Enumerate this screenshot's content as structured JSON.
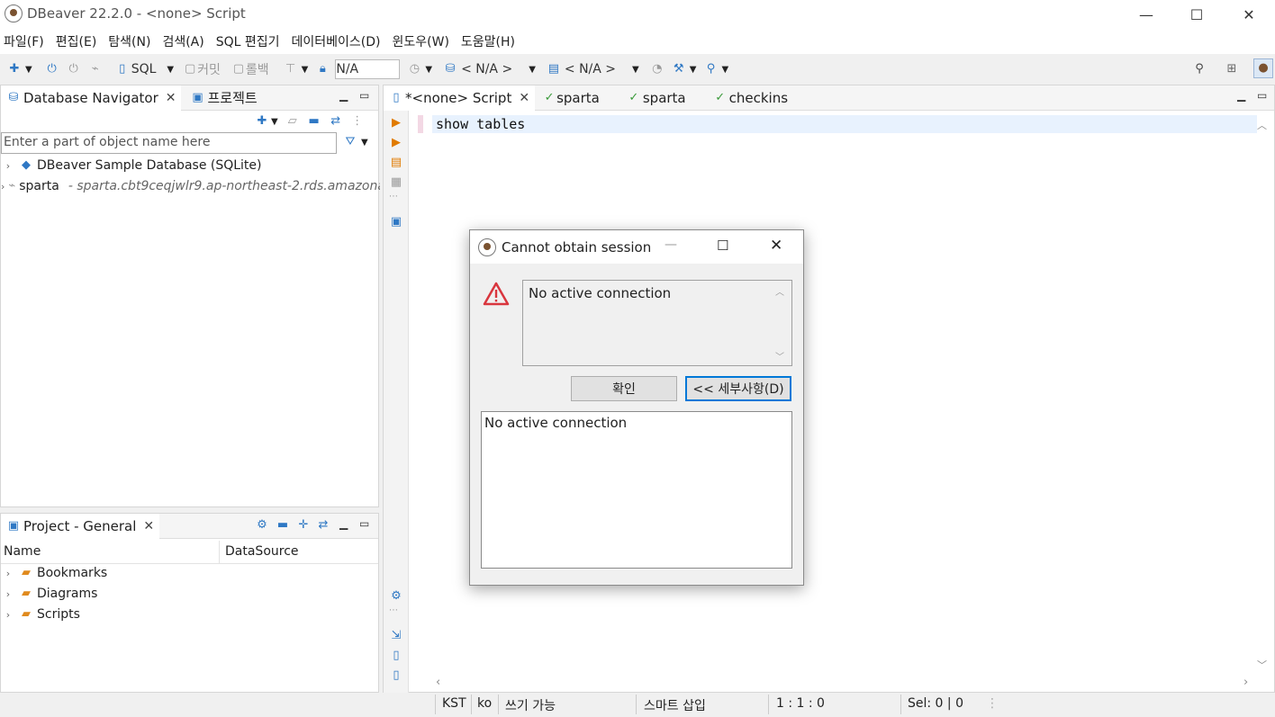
{
  "window": {
    "title": "DBeaver 22.2.0 - <none> Script",
    "minimize_glyph": "—",
    "maximize_glyph": "☐",
    "close_glyph": "✕"
  },
  "menu": [
    "파일(F)",
    "편집(E)",
    "탐색(N)",
    "검색(A)",
    "SQL 편집기",
    "데이터베이스(D)",
    "윈도우(W)",
    "도움말(H)"
  ],
  "toolbar": {
    "sql_label": "SQL",
    "commit_label": "커밋",
    "rollback_label": "롤백",
    "transaction_value": "N/A",
    "datasource_selector": "< N/A >",
    "schema_selector": "< N/A >"
  },
  "navigator": {
    "tabs": [
      {
        "label": "Database Navigator"
      },
      {
        "label": "프로젝트"
      }
    ],
    "filter_placeholder": "Enter a part of object name here",
    "items": [
      {
        "label": "DBeaver Sample Database (SQLite)",
        "detail": ""
      },
      {
        "label": "sparta",
        "detail": "- sparta.cbt9ceqjwlr9.ap-northeast-2.rds.amazona"
      }
    ]
  },
  "project": {
    "tab_label": "Project - General",
    "columns": [
      "Name",
      "DataSource"
    ],
    "items": [
      "Bookmarks",
      "Diagrams",
      "Scripts"
    ]
  },
  "editor": {
    "tabs": [
      {
        "label": "*<none> Script",
        "active": true
      },
      {
        "label": "sparta",
        "active": false
      },
      {
        "label": "sparta",
        "active": false
      },
      {
        "label": "checkins",
        "active": false
      }
    ],
    "code": "show tables"
  },
  "statusbar": {
    "timezone": "KST",
    "locale": "ko",
    "write_mode": "쓰기 가능",
    "insert_mode": "스마트 삽입",
    "cursor": "1 : 1 : 0",
    "selection": "Sel: 0 | 0"
  },
  "dialog": {
    "title": "Cannot obtain session",
    "message": "No active connection",
    "ok_label": "확인",
    "details_label": "<< 세부사항(D)",
    "details_text": "No active connection"
  },
  "colors": {
    "accent": "#2f78c4",
    "warning": "#d9363e",
    "focus_border": "#0078d7"
  }
}
